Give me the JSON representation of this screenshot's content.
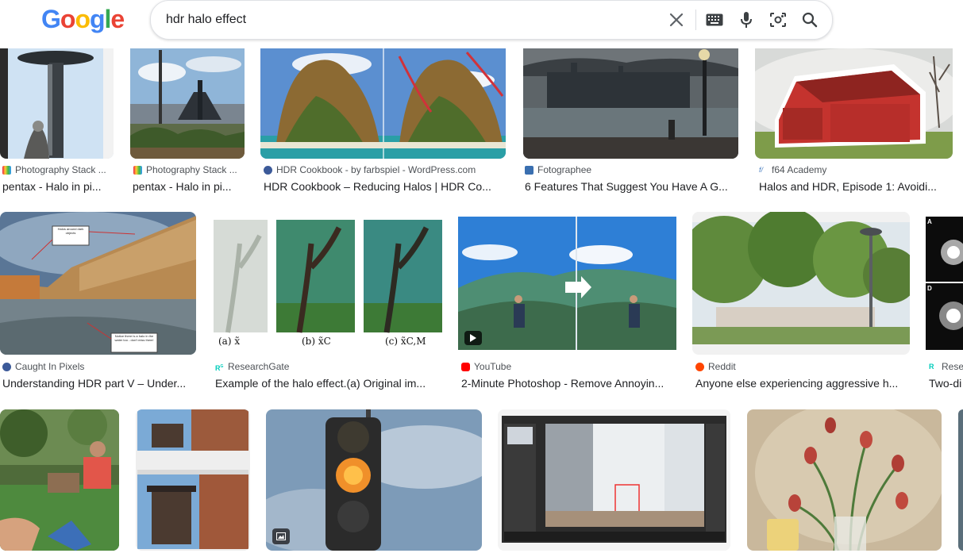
{
  "header": {
    "logo": [
      "G",
      "o",
      "o",
      "g",
      "l",
      "e"
    ],
    "logo_colors": [
      "#4285f4",
      "#ea4335",
      "#fbbc05",
      "#4285f4",
      "#34a853",
      "#ea4335"
    ],
    "search_value": "hdr halo effect"
  },
  "results": [
    {
      "source": "Photography Stack ...",
      "title": "pentax - Halo in pi...",
      "fav": "#6a9fd8"
    },
    {
      "source": "Photography Stack ...",
      "title": "pentax - Halo in pi...",
      "fav": "#6a9fd8"
    },
    {
      "source": "HDR Cookbook - by farbspiel - WordPress.com",
      "title": "HDR Cookbook – Reducing Halos | HDR Co...",
      "fav": "#3c5a99"
    },
    {
      "source": "Fotographee",
      "title": "6 Features That Suggest You Have A G...",
      "fav": "#3a6fb0"
    },
    {
      "source": "f64 Academy",
      "title": "Halos and HDR, Episode 1: Avoidi...",
      "fav": "#4a7fc0"
    },
    {
      "source": "Caught In Pixels",
      "title": "Understanding HDR part V – Under...",
      "fav": "#3c5a99"
    },
    {
      "source": "ResearchGate",
      "title": "Example of the halo effect.(a) Original im...",
      "fav": "#00ccbb"
    },
    {
      "source": "YouTube",
      "title": "2-Minute Photoshop - Remove Annoyin...",
      "fav": "#ff0000"
    },
    {
      "source": "Reddit",
      "title": "Anyone else experiencing aggressive h...",
      "fav": "#ff4500"
    },
    {
      "source": "Rese",
      "title": "Two-di",
      "fav": "#00ccbb"
    }
  ],
  "row1_labels": {
    "callout_a": "Halos around dark objects",
    "callout_b": "Notice there is a halo in the water too - don't miss them!",
    "research_a": "(a) x̃",
    "research_b": "(b) x̃C",
    "research_c": "(c) x̃C,M",
    "panel_a": "A",
    "panel_d": "D"
  },
  "colors": {
    "source_text": "#4d5156",
    "title_text": "#202124",
    "border": "#dfe1e5"
  }
}
